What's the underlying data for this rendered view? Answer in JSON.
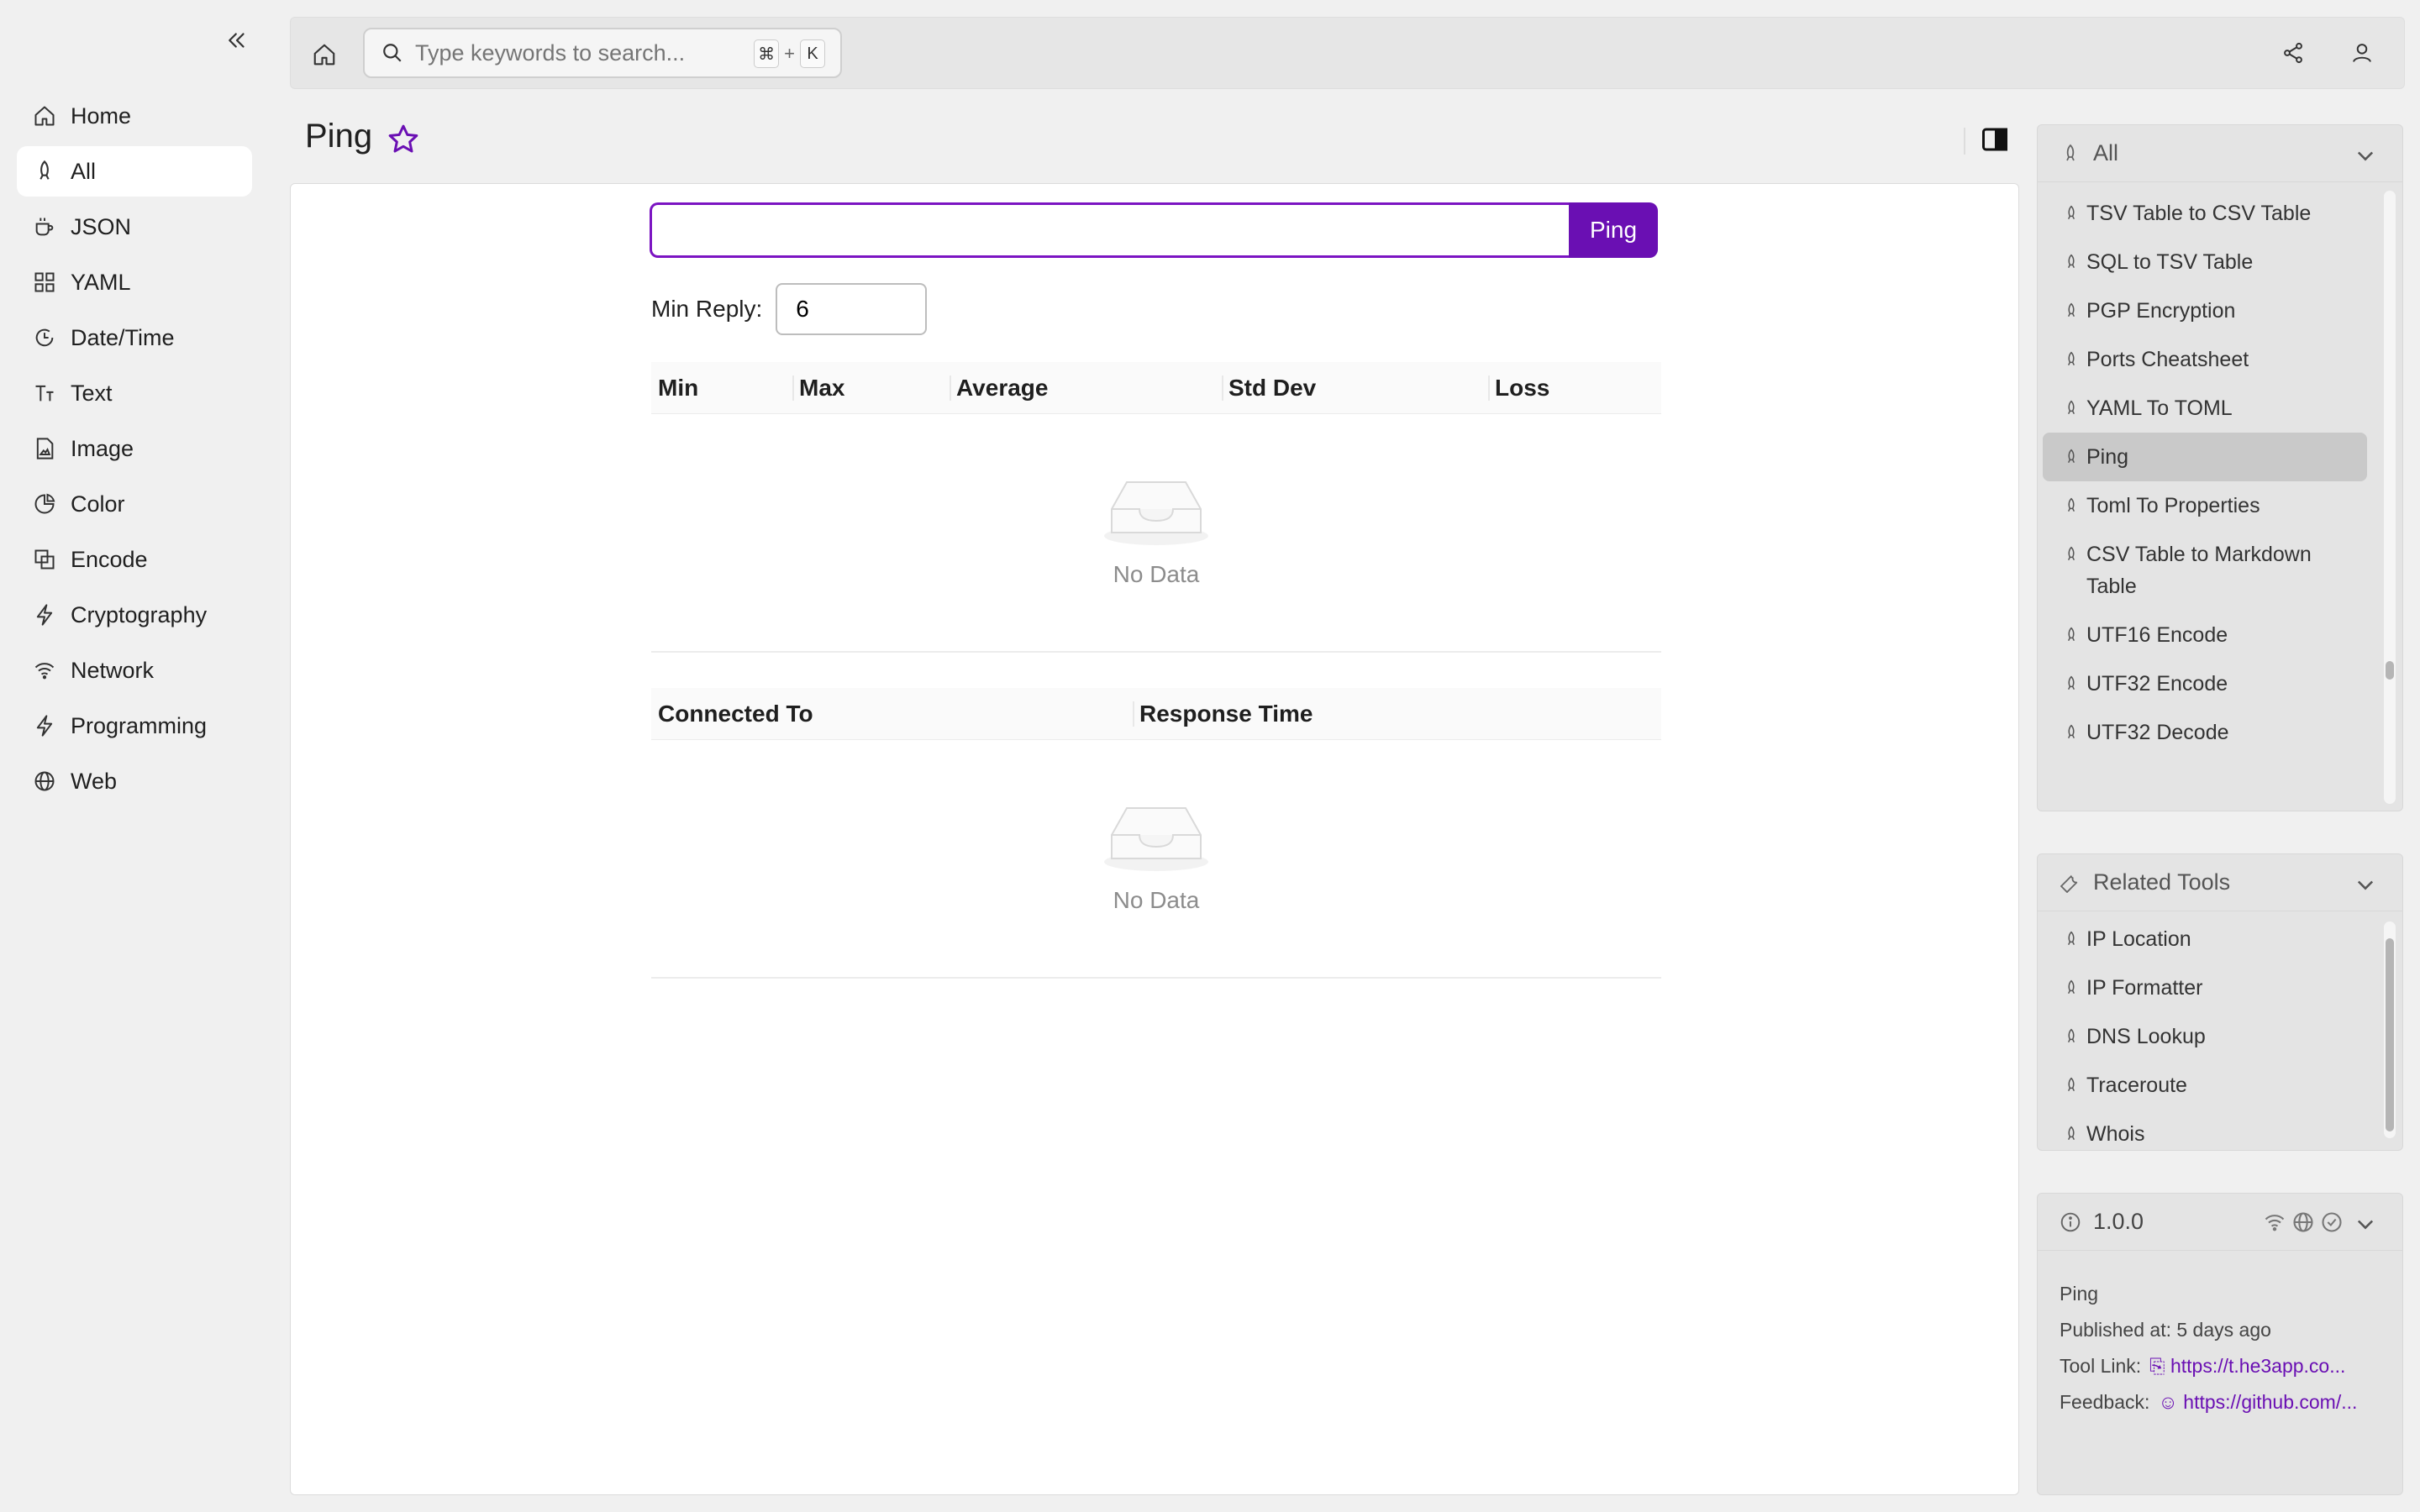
{
  "sidebar": {
    "items": [
      {
        "label": "Home",
        "icon": "home-icon"
      },
      {
        "label": "All",
        "icon": "rocket-icon",
        "active": true
      },
      {
        "label": "JSON",
        "icon": "coffee-icon"
      },
      {
        "label": "YAML",
        "icon": "grid-icon"
      },
      {
        "label": "Date/Time",
        "icon": "clock-icon"
      },
      {
        "label": "Text",
        "icon": "text-icon"
      },
      {
        "label": "Image",
        "icon": "image-file-icon"
      },
      {
        "label": "Color",
        "icon": "pie-icon"
      },
      {
        "label": "Encode",
        "icon": "copy-icon"
      },
      {
        "label": "Cryptography",
        "icon": "lightning-icon"
      },
      {
        "label": "Network",
        "icon": "wifi-icon"
      },
      {
        "label": "Programming",
        "icon": "lightning-icon"
      },
      {
        "label": "Web",
        "icon": "globe-icon"
      }
    ]
  },
  "topbar": {
    "search_placeholder": "Type keywords to search...",
    "shortcut_mod": "⌘",
    "shortcut_plus": "+",
    "shortcut_key": "K"
  },
  "page": {
    "title": "Ping"
  },
  "ping": {
    "input_value": "",
    "button_label": "Ping",
    "min_reply_label": "Min Reply",
    "min_reply_colon": ":",
    "min_reply_value": "6"
  },
  "stats_table": {
    "columns": [
      "Min",
      "Max",
      "Average",
      "Std Dev",
      "Loss"
    ],
    "empty_text": "No Data"
  },
  "conn_table": {
    "columns": [
      "Connected To",
      "Response Time"
    ],
    "empty_text": "No Data"
  },
  "all_panel": {
    "title": "All",
    "items": [
      {
        "label": "TSV Table to CSV Table"
      },
      {
        "label": "SQL to TSV Table"
      },
      {
        "label": "PGP Encryption"
      },
      {
        "label": "Ports Cheatsheet"
      },
      {
        "label": "YAML To TOML"
      },
      {
        "label": "Ping",
        "active": true
      },
      {
        "label": "Toml To Properties"
      },
      {
        "label": "CSV Table to Markdown Table"
      },
      {
        "label": "UTF16 Encode"
      },
      {
        "label": "UTF32 Encode"
      },
      {
        "label": "UTF32 Decode"
      }
    ]
  },
  "related_panel": {
    "title": "Related Tools",
    "items": [
      {
        "label": "IP Location"
      },
      {
        "label": "IP Formatter"
      },
      {
        "label": "DNS Lookup"
      },
      {
        "label": "Traceroute"
      },
      {
        "label": "Whois"
      }
    ]
  },
  "version_panel": {
    "version": "1.0.0",
    "tool_name": "Ping",
    "published": "Published at: 5 days ago",
    "tool_link_label": "Tool Link:",
    "tool_link": "https://t.he3app.co...",
    "feedback_label": "Feedback:",
    "feedback_link": "https://github.com/..."
  },
  "colors": {
    "accent": "#6a0fb3",
    "accent_border": "#7b14c2"
  }
}
